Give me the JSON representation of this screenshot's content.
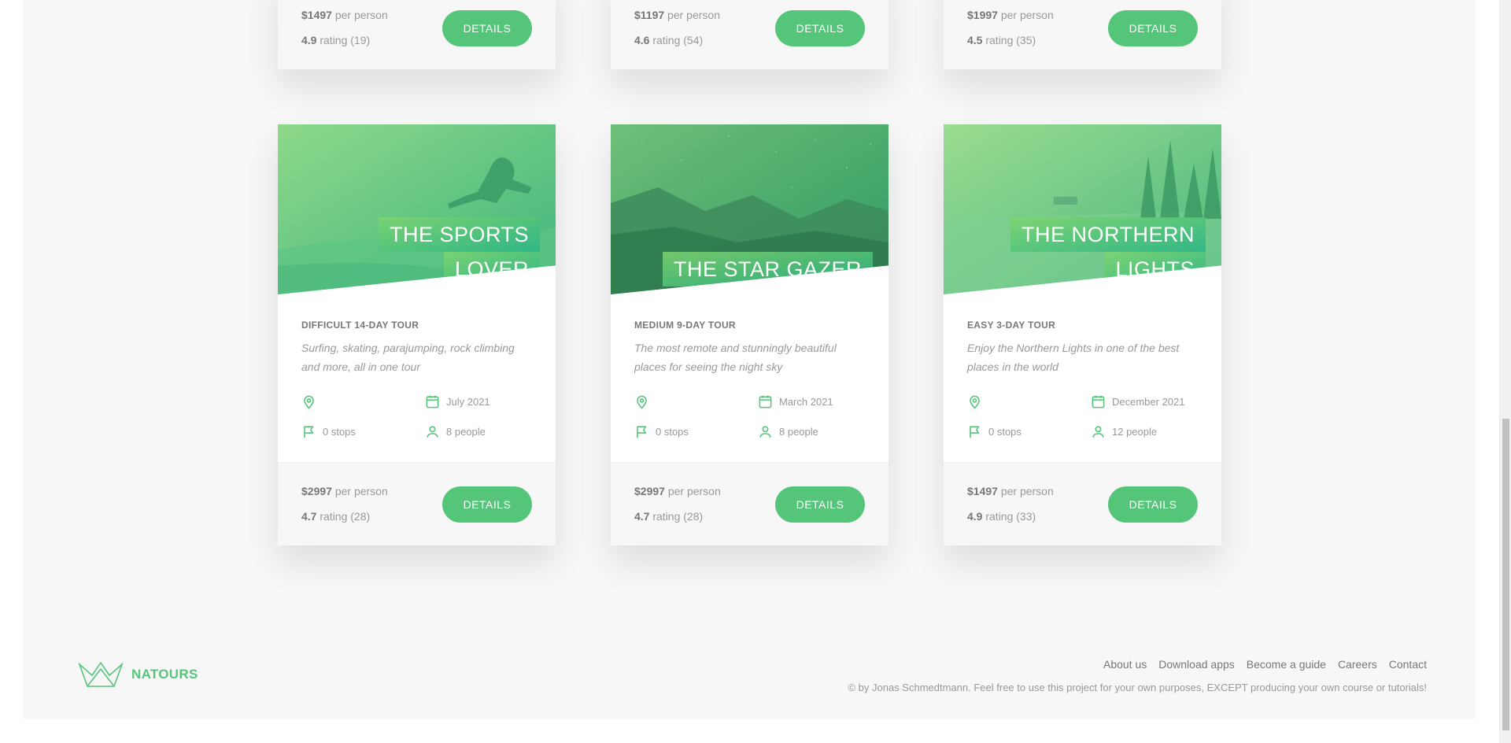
{
  "top_cards": [
    {
      "price": "$1497",
      "price_suffix": " per person",
      "rating": "4.9",
      "rating_suffix": " rating (19)",
      "button": "DETAILS"
    },
    {
      "price": "$1197",
      "price_suffix": " per person",
      "rating": "4.6",
      "rating_suffix": " rating (54)",
      "button": "DETAILS"
    },
    {
      "price": "$1997",
      "price_suffix": " per person",
      "rating": "4.5",
      "rating_suffix": " rating (35)",
      "button": "DETAILS"
    }
  ],
  "cards": [
    {
      "title_lines": [
        "THE SPORTS",
        "LOVER"
      ],
      "subheading": "DIFFICULT 14-DAY TOUR",
      "description": "Surfing, skating, parajumping, rock climbing and more, all in one tour",
      "date": "July 2021",
      "stops": "0 stops",
      "people": "8 people",
      "price": "$2997",
      "price_suffix": " per person",
      "rating": "4.7",
      "rating_suffix": " rating (28)",
      "button": "DETAILS"
    },
    {
      "title_lines": [
        "THE STAR GAZER"
      ],
      "subheading": "MEDIUM 9-DAY TOUR",
      "description": "The most remote and stunningly beautiful places for seeing the night sky",
      "date": "March 2021",
      "stops": "0 stops",
      "people": "8 people",
      "price": "$2997",
      "price_suffix": " per person",
      "rating": "4.7",
      "rating_suffix": " rating (28)",
      "button": "DETAILS"
    },
    {
      "title_lines": [
        "THE NORTHERN",
        "LIGHTS"
      ],
      "subheading": "EASY 3-DAY TOUR",
      "description": "Enjoy the Northern Lights in one of the best places in the world",
      "date": "December 2021",
      "stops": "0 stops",
      "people": "12 people",
      "price": "$1497",
      "price_suffix": " per person",
      "rating": "4.9",
      "rating_suffix": " rating (33)",
      "button": "DETAILS"
    }
  ],
  "footer": {
    "logo_text": "NATOURS",
    "nav": [
      "About us",
      "Download apps",
      "Become a guide",
      "Careers",
      "Contact"
    ],
    "copyright": "© by Jonas Schmedtmann. Feel free to use this project for your own purposes, EXCEPT producing your own course or tutorials!"
  },
  "colors": {
    "accent": "#55c57a",
    "accent_dark": "#28b485",
    "accent_light": "#7ed56f"
  },
  "icons": [
    "map-pin-icon",
    "calendar-icon",
    "flag-icon",
    "user-icon",
    "crown-logo-icon"
  ]
}
